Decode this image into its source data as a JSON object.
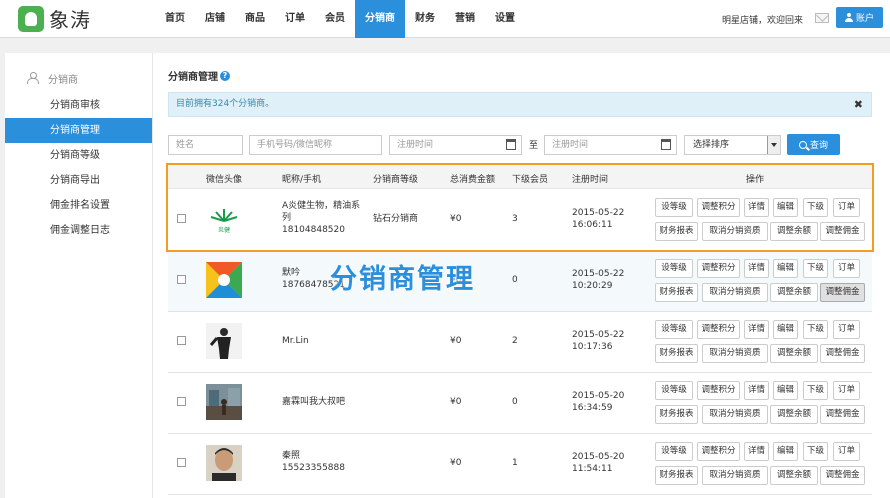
{
  "app": {
    "logo_text": "象涛",
    "shop_welcome": "明星店铺，欢迎回来",
    "account_label": "账户"
  },
  "nav": [
    "首页",
    "店铺",
    "商品",
    "订单",
    "会员",
    "分销商",
    "财务",
    "营销",
    "设置"
  ],
  "nav_active": "分销商",
  "sidebar": {
    "heading": "分销商",
    "items": [
      "分销商审核",
      "分销商管理",
      "分销商等级",
      "分销商导出",
      "佣金排名设置",
      "佣金调整日志"
    ],
    "active": "分销商管理"
  },
  "page": {
    "title": "分销商管理",
    "notice": "目前拥有324个分销商。",
    "watermark": "分销商管理"
  },
  "filters": {
    "name_placeholder": "姓名",
    "phone_placeholder": "手机号码/微信昵称",
    "start_placeholder": "注册时间",
    "to_label": "至",
    "end_placeholder": "注册时间",
    "sort_label": "选择排序",
    "query_label": "查询"
  },
  "table": {
    "headers": [
      "微信头像",
      "昵称/手机",
      "分销商等级",
      "总消费金额",
      "下级会员",
      "注册时间",
      "操作"
    ],
    "actions_row1": [
      "设等级",
      "调整积分",
      "详情",
      "编辑",
      "下级",
      "订单"
    ],
    "actions_row2": [
      "财务报表",
      "取消分销资质",
      "调整余额",
      "调整佣金"
    ],
    "rows": [
      {
        "name": "A炎健生物，精油系列",
        "phone": "18104848520",
        "level": "钻石分销商",
        "amount": "¥0",
        "sub": "3",
        "date": "2015-05-22",
        "time": "16:06:11",
        "avatar": "brand-logo",
        "avatar_text": "炎健"
      },
      {
        "name": "默吟",
        "phone": "18768478521",
        "level": "",
        "amount": "¥0",
        "sub": "0",
        "date": "2015-05-22",
        "time": "10:20:29",
        "avatar": "colorful"
      },
      {
        "name": "Mr.Lin",
        "phone": "",
        "level": "",
        "amount": "¥0",
        "sub": "2",
        "date": "2015-05-22",
        "time": "10:17:36",
        "avatar": "person-dark"
      },
      {
        "name": "嘉霖叫我大叔吧",
        "phone": "",
        "level": "",
        "amount": "¥0",
        "sub": "0",
        "date": "2015-05-20",
        "time": "16:34:59",
        "avatar": "street"
      },
      {
        "name": "秦照",
        "phone": "15523355888",
        "level": "",
        "amount": "¥0",
        "sub": "1",
        "date": "2015-05-20",
        "time": "11:54:11",
        "avatar": "face"
      }
    ]
  }
}
